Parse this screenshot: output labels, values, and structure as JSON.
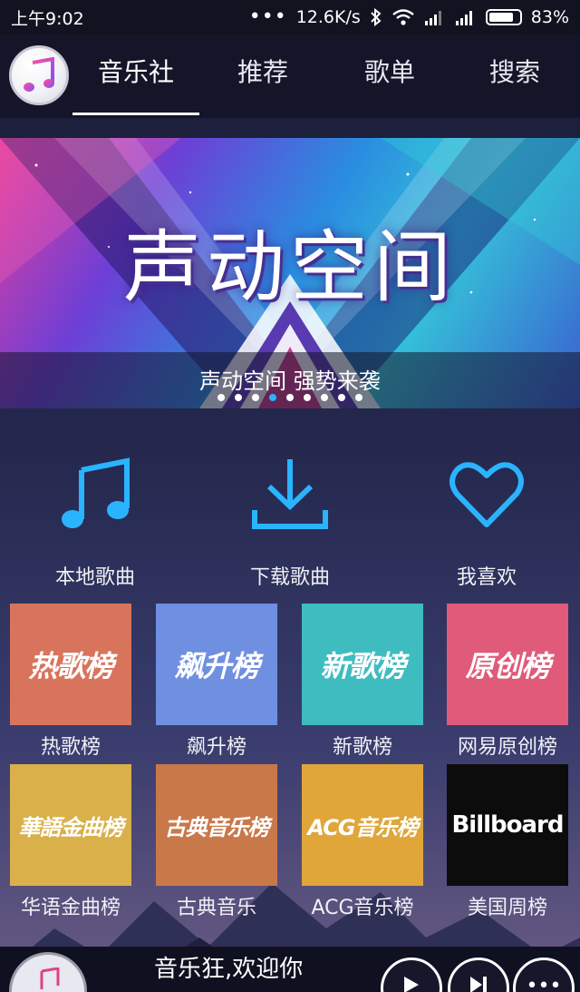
{
  "status_bar": {
    "time": "上午9:02",
    "network_speed": "12.6K/s",
    "battery": "83%",
    "battery_level": 0.83
  },
  "nav": {
    "logo_icon": "music-note-icon",
    "tabs": [
      {
        "label": "音乐社",
        "active": true
      },
      {
        "label": "推荐",
        "active": false
      },
      {
        "label": "歌单",
        "active": false
      },
      {
        "label": "搜索",
        "active": false
      }
    ]
  },
  "banner": {
    "title": "声动空间",
    "caption": "声动空间 强势来袭",
    "pages": 9,
    "active_page": 3
  },
  "quick_actions": [
    {
      "label": "本地歌曲",
      "icon": "music-note-icon"
    },
    {
      "label": "下载歌曲",
      "icon": "download-icon"
    },
    {
      "label": "我喜欢",
      "icon": "heart-icon"
    }
  ],
  "charts": [
    {
      "name": "热歌榜",
      "cover_text": "热歌榜",
      "color": "#d9745c"
    },
    {
      "name": "飙升榜",
      "cover_text": "飙升榜",
      "color": "#6f8fe0"
    },
    {
      "name": "新歌榜",
      "cover_text": "新歌榜",
      "color": "#3fbcc0"
    },
    {
      "name": "网易原创榜",
      "cover_text": "原创榜",
      "color": "#e05a79"
    },
    {
      "name": "华语金曲榜",
      "cover_text": "華語金曲榜",
      "color": "#d9b04a"
    },
    {
      "name": "古典音乐",
      "cover_text": "古典音乐榜",
      "color": "#c9784a"
    },
    {
      "name": "ACG音乐榜",
      "cover_text": "ACG音乐榜",
      "color": "#e0a63a"
    },
    {
      "name": "美国周榜",
      "cover_text": "Billboard",
      "color": "#0c0c0c"
    }
  ],
  "player": {
    "text": "音乐狂,欢迎你"
  }
}
